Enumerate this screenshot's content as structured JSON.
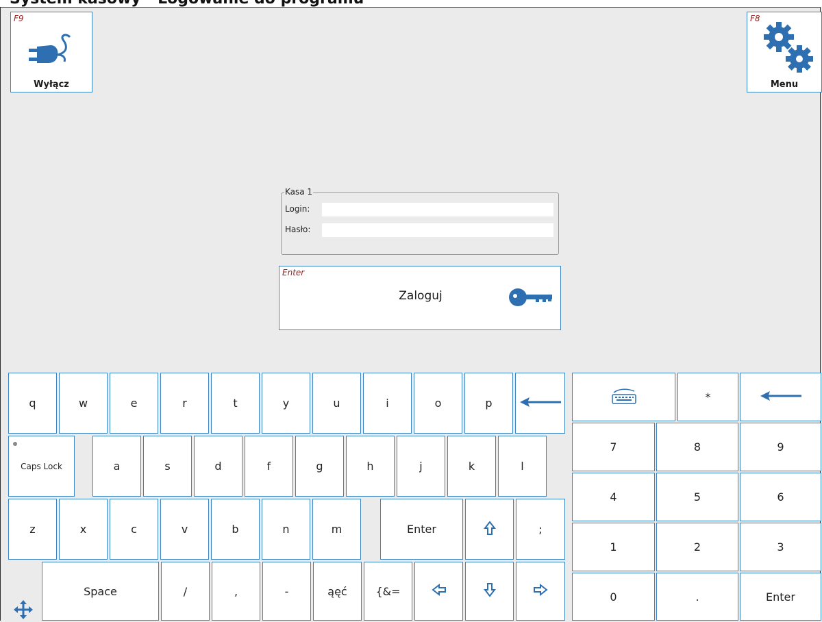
{
  "window": {
    "title": "System kasowy - Logowanie do programu"
  },
  "shutdown": {
    "fkey": "F9",
    "label": "Wyłącz",
    "icon": "power-plug-icon"
  },
  "menu": {
    "fkey": "F8",
    "label": "Menu",
    "icon": "gears-icon"
  },
  "login_group": {
    "title": "Kasa 1",
    "login_label": "Login:",
    "login_value": "",
    "password_label": "Hasło:",
    "password_value": ""
  },
  "login_button": {
    "fkey": "Enter",
    "label": "Zaloguj",
    "icon": "key-icon"
  },
  "keyboard": {
    "row1": [
      "q",
      "w",
      "e",
      "r",
      "t",
      "y",
      "u",
      "i",
      "o",
      "p"
    ],
    "backspace_icon": "backspace-arrow-icon",
    "capslock_label": "Caps Lock",
    "row2": [
      "a",
      "s",
      "d",
      "f",
      "g",
      "h",
      "j",
      "k",
      "l"
    ],
    "row3": [
      "z",
      "x",
      "c",
      "v",
      "b",
      "n",
      "m"
    ],
    "enter_label": "Enter",
    "shift_icon": "shift-arrow-icon",
    "semicolon": ";",
    "space_label": "Space",
    "row4": [
      "/",
      ",",
      "-"
    ],
    "polish_label": "ąęć",
    "symbols_label": "{&=",
    "arrow_icons": [
      "arrow-left-icon",
      "arrow-down-icon",
      "arrow-right-icon"
    ],
    "move_icon": "move-icon"
  },
  "numpad": {
    "keyboard_icon": "keyboard-icon",
    "asterisk": "*",
    "backspace_icon": "backspace-arrow-icon",
    "digits": [
      "7",
      "8",
      "9",
      "4",
      "5",
      "6",
      "1",
      "2",
      "3",
      "0",
      "."
    ],
    "enter_label": "Enter"
  },
  "colors": {
    "accent": "#3a84c4",
    "fkey": "#9b1c1c",
    "icon": "#2d6fb0",
    "background": "#ebebeb"
  }
}
